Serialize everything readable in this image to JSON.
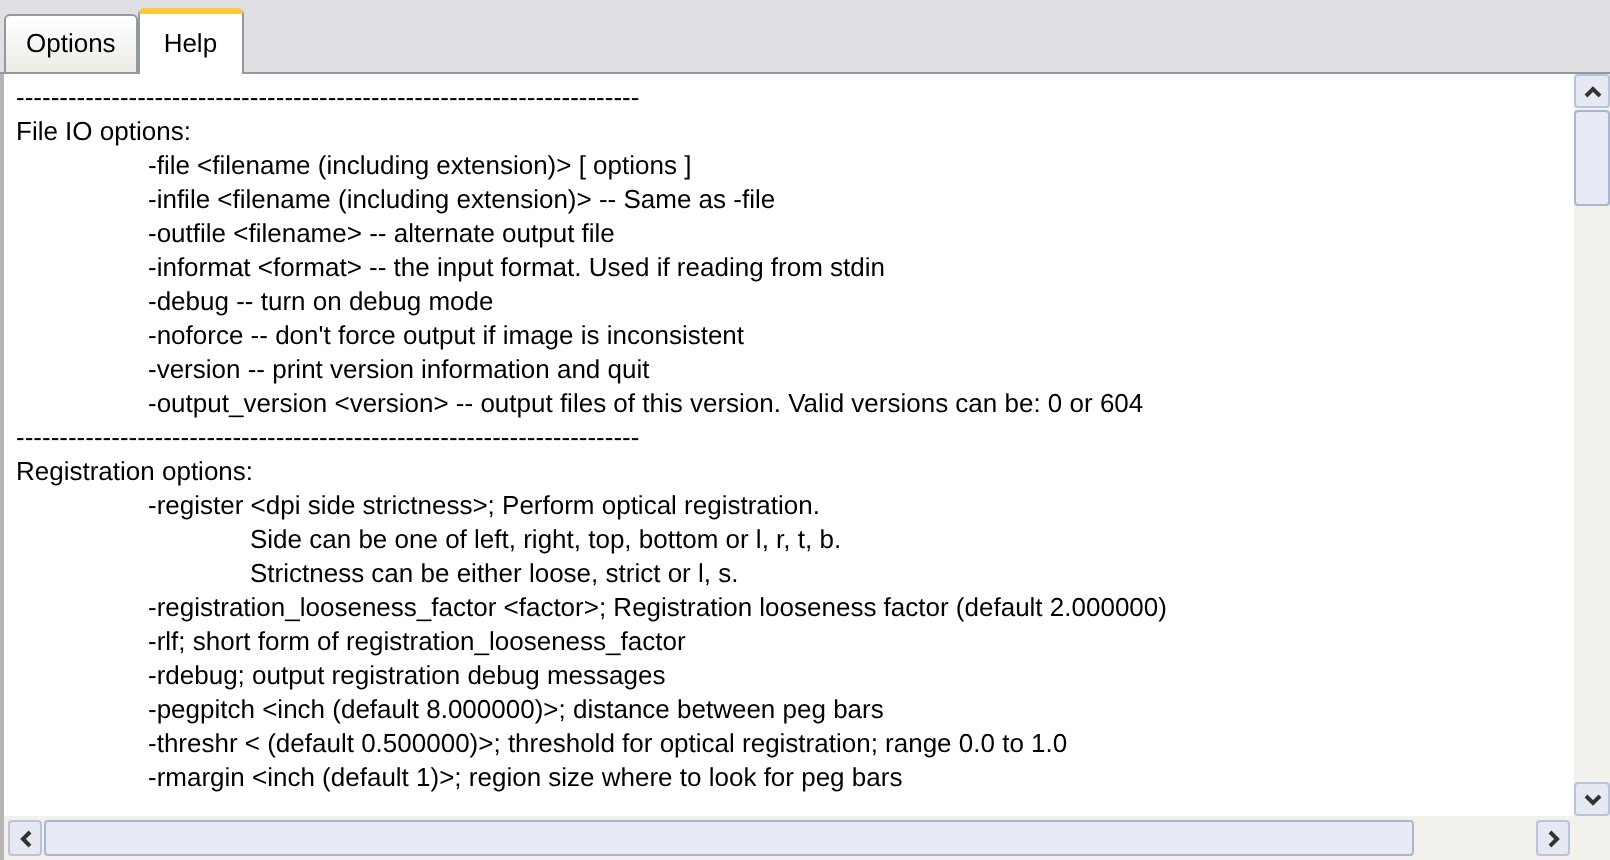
{
  "tabs": [
    {
      "label": "Options",
      "selected": false
    },
    {
      "label": "Help",
      "selected": true
    }
  ],
  "help_text": [
    {
      "kind": "separator",
      "text": "------------------------------------------------------------------------"
    },
    {
      "kind": "heading",
      "text": "File IO options:"
    },
    {
      "kind": "option",
      "text": "-file <filename (including extension)> [ options ]"
    },
    {
      "kind": "option",
      "text": "-infile <filename (including extension)> -- Same as -file"
    },
    {
      "kind": "option",
      "text": "-outfile <filename> -- alternate output file"
    },
    {
      "kind": "option",
      "text": "-informat <format> -- the input format. Used if reading from stdin"
    },
    {
      "kind": "option",
      "text": "-debug -- turn on debug mode"
    },
    {
      "kind": "option",
      "text": "-noforce -- don't force output if image is inconsistent"
    },
    {
      "kind": "option",
      "text": "-version -- print version information and quit"
    },
    {
      "kind": "option",
      "text": "-output_version <version> -- output files of this version. Valid versions can be: 0 or 604"
    },
    {
      "kind": "separator",
      "text": "------------------------------------------------------------------------"
    },
    {
      "kind": "heading",
      "text": "Registration options:"
    },
    {
      "kind": "option",
      "text": "-register <dpi side strictness>; Perform optical registration."
    },
    {
      "kind": "detail",
      "text": "Side can be one of left, right, top, bottom or l, r, t, b."
    },
    {
      "kind": "detail",
      "text": "Strictness can be either loose, strict or l, s."
    },
    {
      "kind": "option",
      "text": "-registration_looseness_factor <factor>; Registration looseness factor (default 2.000000)"
    },
    {
      "kind": "option",
      "text": "-rlf; short form of registration_looseness_factor"
    },
    {
      "kind": "option",
      "text": "-rdebug; output registration debug messages"
    },
    {
      "kind": "option",
      "text": "-pegpitch <inch (default 8.000000)>; distance between peg bars"
    },
    {
      "kind": "option",
      "text": "-threshr < (default 0.500000)>; threshold for optical registration; range 0.0 to 1.0"
    },
    {
      "kind": "option",
      "text": "-rmargin <inch (default 1)>; region size where to look for peg bars"
    }
  ]
}
